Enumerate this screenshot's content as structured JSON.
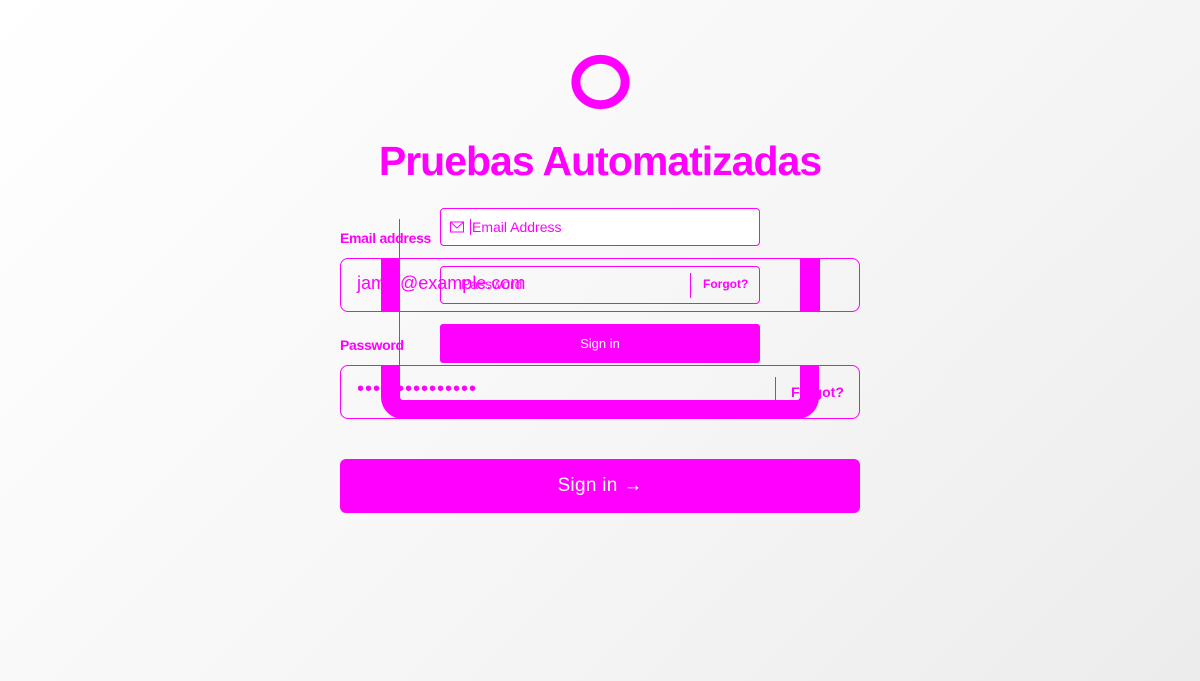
{
  "app": {
    "title": "Pruebas Automatizadas",
    "logo_icon": "ring-logo-icon"
  },
  "colors": {
    "accent": "#ff00ff",
    "background": "#f6f6f6",
    "button_text": "#ffffff"
  },
  "form": {
    "email_label": "Email address",
    "email_value": "jamie@example.com",
    "password_label": "Password",
    "password_value": "•••••••••••••••",
    "forgot_label": "Forgot?",
    "signin_label": "Sign in →"
  },
  "ghost_form": {
    "email_placeholder": "Email Address",
    "email_icon": "envelope-icon",
    "password_placeholder": "Password",
    "forgot_label": "Forgot?",
    "signin_label": "Sign in"
  }
}
